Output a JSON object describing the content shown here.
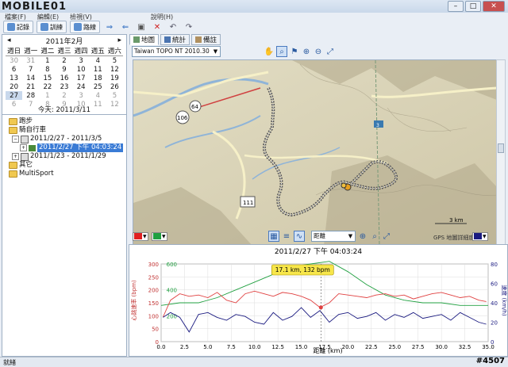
{
  "window": {
    "watermark": "MOBILE01"
  },
  "menu": [
    "檔案(F)",
    "編輯(E)",
    "檢視(V)",
    "說明(H)"
  ],
  "toolbar": {
    "record": "記錄",
    "course": "訓練",
    "route": "路線"
  },
  "calendar": {
    "month_label": "2011年2月",
    "prev": "◂",
    "next": "▸",
    "weekdays": [
      "週日",
      "週一",
      "週二",
      "週三",
      "週四",
      "週五",
      "週六"
    ],
    "weeks": [
      [
        {
          "d": "30",
          "dim": true
        },
        {
          "d": "31",
          "dim": true
        },
        {
          "d": "1"
        },
        {
          "d": "2"
        },
        {
          "d": "3"
        },
        {
          "d": "4"
        },
        {
          "d": "5"
        }
      ],
      [
        {
          "d": "6"
        },
        {
          "d": "7"
        },
        {
          "d": "8"
        },
        {
          "d": "9"
        },
        {
          "d": "10"
        },
        {
          "d": "11"
        },
        {
          "d": "12"
        }
      ],
      [
        {
          "d": "13"
        },
        {
          "d": "14"
        },
        {
          "d": "15"
        },
        {
          "d": "16"
        },
        {
          "d": "17"
        },
        {
          "d": "18"
        },
        {
          "d": "19"
        }
      ],
      [
        {
          "d": "20"
        },
        {
          "d": "21"
        },
        {
          "d": "22"
        },
        {
          "d": "23"
        },
        {
          "d": "24"
        },
        {
          "d": "25"
        },
        {
          "d": "26"
        }
      ],
      [
        {
          "d": "27",
          "sel": true
        },
        {
          "d": "28"
        },
        {
          "d": "1",
          "dim": true
        },
        {
          "d": "2",
          "dim": true
        },
        {
          "d": "3",
          "dim": true
        },
        {
          "d": "4",
          "dim": true
        },
        {
          "d": "5",
          "dim": true
        }
      ],
      [
        {
          "d": "6",
          "dim": true
        },
        {
          "d": "7",
          "dim": true
        },
        {
          "d": "8",
          "dim": true
        },
        {
          "d": "9",
          "dim": true
        },
        {
          "d": "10",
          "dim": true
        },
        {
          "d": "11",
          "dim": true
        },
        {
          "d": "12",
          "dim": true
        }
      ]
    ],
    "today": "今天: 2011/3/11"
  },
  "tree": {
    "running": "跑步",
    "cycling": "騎自行車",
    "week1": "2011/2/27 - 2011/3/5",
    "activity": "2011/2/27 下午 04:03:24",
    "week2": "2011/1/23 - 2011/1/29",
    "other": "其它",
    "multisport": "MultiSport"
  },
  "tabs": {
    "map": "地圖",
    "stats": "統計",
    "notes": "備註"
  },
  "map": {
    "selector": "Taiwan TOPO NT 2010.30",
    "scale_label": "3 km",
    "copyright": "GPS 地圖詳細度",
    "road_labels": [
      "106",
      "64",
      "111",
      "3"
    ]
  },
  "chart_toolbar": {
    "axis_select": "距離"
  },
  "chart_data": {
    "type": "line",
    "title": "2011/2/27 下午 04:03:24",
    "xlabel": "距離 (km)",
    "ylabel_left": "心跳速率 (bpm)",
    "ylabel_right": "速度 (km/h)",
    "xlim": [
      0,
      35
    ],
    "ylim_left": [
      0,
      300
    ],
    "ylim_right": [
      0,
      80
    ],
    "xticks": [
      "0.0",
      "2.5",
      "5.0",
      "7.5",
      "10.0",
      "12.5",
      "15.0",
      "17.5",
      "20.0",
      "22.5",
      "25.0",
      "27.5",
      "30.0",
      "32.5",
      "35.0"
    ],
    "yticks_left": [
      "0",
      "50",
      "100",
      "150",
      "200",
      "250",
      "300"
    ],
    "yticks_right": [
      "0",
      "20",
      "40",
      "60",
      "80"
    ],
    "elevation_ticks": [
      "200",
      "400",
      "600"
    ],
    "tooltip": "17.1 km, 132 bpm",
    "heart_rate": {
      "x": [
        0.2,
        1,
        2,
        3,
        4,
        5,
        6,
        7,
        8,
        9,
        10,
        11,
        12,
        13,
        14,
        15,
        16,
        17,
        18,
        19,
        20,
        21,
        22,
        23,
        24,
        25,
        26,
        27,
        28,
        29,
        30,
        31,
        32,
        33,
        34,
        34.8
      ],
      "y": [
        95,
        160,
        185,
        175,
        180,
        170,
        190,
        160,
        150,
        185,
        195,
        185,
        175,
        190,
        185,
        175,
        160,
        132,
        150,
        185,
        180,
        175,
        170,
        180,
        185,
        175,
        180,
        165,
        175,
        185,
        190,
        180,
        170,
        175,
        160,
        155
      ]
    },
    "speed": {
      "x": [
        0.2,
        1,
        2,
        3,
        4,
        5,
        6,
        7,
        8,
        9,
        10,
        11,
        12,
        13,
        14,
        15,
        16,
        17,
        18,
        19,
        20,
        21,
        22,
        23,
        24,
        25,
        26,
        27,
        28,
        29,
        30,
        31,
        32,
        33,
        34,
        34.8
      ],
      "y": [
        25,
        30,
        25,
        10,
        28,
        30,
        25,
        22,
        28,
        26,
        20,
        18,
        30,
        22,
        26,
        35,
        25,
        32,
        20,
        28,
        30,
        24,
        26,
        30,
        22,
        28,
        25,
        30,
        24,
        26,
        28,
        22,
        30,
        25,
        20,
        18
      ]
    },
    "elevation": {
      "x": [
        0,
        2,
        4,
        6,
        8,
        10,
        12,
        14,
        16,
        18,
        20,
        22,
        24,
        26,
        28,
        30,
        32,
        34,
        35
      ],
      "y": [
        140,
        150,
        150,
        170,
        200,
        230,
        260,
        290,
        300,
        310,
        270,
        220,
        180,
        160,
        150,
        150,
        140,
        140,
        140
      ]
    }
  },
  "status": {
    "text": "就緒",
    "watermark": "#4507"
  }
}
